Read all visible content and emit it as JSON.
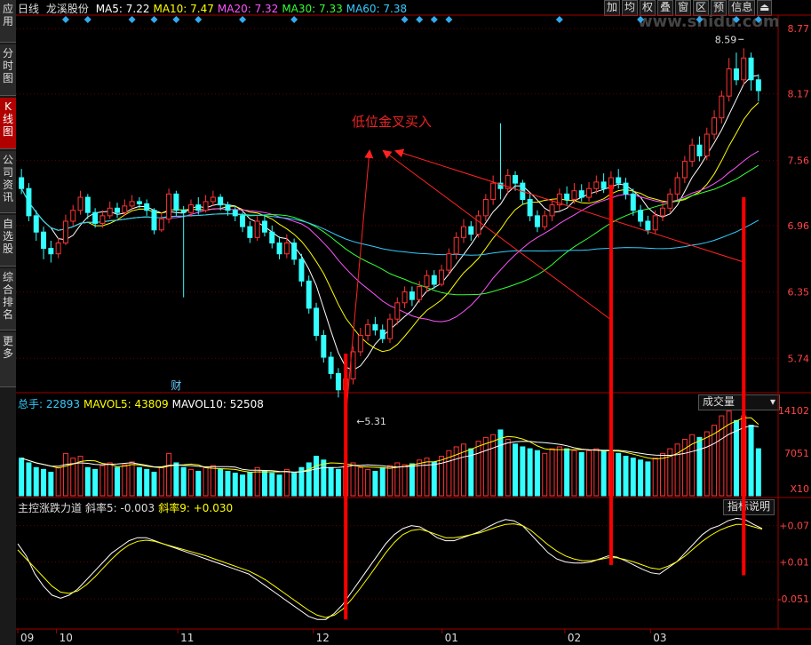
{
  "sidebar": {
    "tabs": [
      {
        "label": "应用",
        "active": false
      },
      {
        "label": "分时图",
        "active": false
      },
      {
        "label": "K线图",
        "active": true
      },
      {
        "label": "公司资讯",
        "active": false
      },
      {
        "label": "自选股",
        "active": false
      },
      {
        "label": "综合排名",
        "active": false
      },
      {
        "label": "更多",
        "active": false
      }
    ]
  },
  "toolbar": {
    "buttons": [
      "加",
      "均",
      "权",
      "叠",
      "窗",
      "区",
      "预",
      "信息"
    ]
  },
  "watermark": "www.shidu.com",
  "header": {
    "period": "日线",
    "name": "龙溪股份",
    "ma": [
      {
        "label": "MA5: 7.22",
        "color": "#ffffff"
      },
      {
        "label": "MA10: 7.47",
        "color": "#ffff00"
      },
      {
        "label": "MA20: 7.32",
        "color": "#ff55ff"
      },
      {
        "label": "MA30: 7.33",
        "color": "#33ff33"
      },
      {
        "label": "MA60: 7.38",
        "color": "#33ccff"
      }
    ]
  },
  "volume_header": {
    "items": [
      {
        "label": "总手: 22893",
        "color": "#33ccff"
      },
      {
        "label": "MAVOL5: 43809",
        "color": "#ffff00"
      },
      {
        "label": "MAVOL10: 52508",
        "color": "#ffffff"
      }
    ],
    "dropdown": "成交量"
  },
  "indicator_header": {
    "items": [
      {
        "label": "主控涨跌力道",
        "color": "#dddddd"
      },
      {
        "label": "斜率5: -0.003",
        "color": "#dddddd"
      },
      {
        "label": "斜率9: +0.030",
        "color": "#ffff00"
      }
    ],
    "button": "指标说明"
  },
  "annotation": "低位金叉买入",
  "price_axis": [
    "8.77",
    "8.17",
    "7.56",
    "6.96",
    "6.35",
    "5.74"
  ],
  "volume_axis": [
    "14102",
    "7051",
    "X10"
  ],
  "indicator_axis": [
    "+0.07",
    "+0.01",
    "-0.051"
  ],
  "x_labels": [
    "09",
    "10",
    "11",
    "12",
    "01",
    "02",
    "03"
  ],
  "finance_marker": "财",
  "colors": {
    "up": "#ff3333",
    "down": "#33ffff",
    "arrow": "#ff2222",
    "ma5": "#ffffff",
    "ma10": "#ffff00",
    "ma20": "#ff55ff",
    "ma30": "#33ff33",
    "ma60": "#33ccff"
  },
  "chart_data": {
    "type": "candlestick",
    "price_range": [
      5.44,
      8.87
    ],
    "high_label": "8.59",
    "low_label": "5.31",
    "diamond_days": [
      6,
      9,
      15,
      18,
      21,
      24,
      30,
      37,
      52,
      54,
      56,
      58,
      73,
      84,
      92,
      97,
      100
    ],
    "candles": [
      [
        7.4,
        7.3,
        7.48,
        7.25
      ],
      [
        7.3,
        7.05,
        7.35,
        7.0
      ],
      [
        7.05,
        6.9,
        7.1,
        6.82
      ],
      [
        6.9,
        6.75,
        6.95,
        6.65
      ],
      [
        6.75,
        6.7,
        6.82,
        6.62
      ],
      [
        6.7,
        6.8,
        6.85,
        6.66
      ],
      [
        6.8,
        7.0,
        7.06,
        6.78
      ],
      [
        7.0,
        7.1,
        7.15,
        6.96
      ],
      [
        7.1,
        7.22,
        7.28,
        7.06
      ],
      [
        7.22,
        7.08,
        7.25,
        7.02
      ],
      [
        7.08,
        6.98,
        7.12,
        6.94
      ],
      [
        6.98,
        7.05,
        7.1,
        6.94
      ],
      [
        7.05,
        7.12,
        7.18,
        7.02
      ],
      [
        7.12,
        7.08,
        7.17,
        7.03
      ],
      [
        7.08,
        7.14,
        7.2,
        7.05
      ],
      [
        7.14,
        7.18,
        7.24,
        7.1
      ],
      [
        7.18,
        7.16,
        7.22,
        7.12
      ],
      [
        7.16,
        7.1,
        7.2,
        7.05
      ],
      [
        7.1,
        6.92,
        7.12,
        6.88
      ],
      [
        6.92,
        7.02,
        7.08,
        6.9
      ],
      [
        7.02,
        7.25,
        7.3,
        6.98
      ],
      [
        7.25,
        7.1,
        7.28,
        7.05
      ],
      [
        7.1,
        7.08,
        7.14,
        6.3
      ],
      [
        7.08,
        7.15,
        7.2,
        7.04
      ],
      [
        7.15,
        7.1,
        7.22,
        7.06
      ],
      [
        7.1,
        7.18,
        7.24,
        7.08
      ],
      [
        7.18,
        7.22,
        7.28,
        7.14
      ],
      [
        7.22,
        7.15,
        7.25,
        7.1
      ],
      [
        7.15,
        7.1,
        7.18,
        7.05
      ],
      [
        7.1,
        7.05,
        7.14,
        7.0
      ],
      [
        7.05,
        6.95,
        7.08,
        6.9
      ],
      [
        6.95,
        6.85,
        7.0,
        6.8
      ],
      [
        6.85,
        7.0,
        7.05,
        6.82
      ],
      [
        7.0,
        6.9,
        7.06,
        6.86
      ],
      [
        6.9,
        6.8,
        6.96,
        6.75
      ],
      [
        6.8,
        6.7,
        6.86,
        6.65
      ],
      [
        6.7,
        6.8,
        6.88,
        6.66
      ],
      [
        6.8,
        6.65,
        6.84,
        6.6
      ],
      [
        6.65,
        6.45,
        6.7,
        6.4
      ],
      [
        6.45,
        6.2,
        6.5,
        6.15
      ],
      [
        6.2,
        5.95,
        6.25,
        5.9
      ],
      [
        5.95,
        5.75,
        6.0,
        5.7
      ],
      [
        5.75,
        5.6,
        5.8,
        5.55
      ],
      [
        5.6,
        5.45,
        5.65,
        5.38
      ],
      [
        5.45,
        5.55,
        5.6,
        5.31
      ],
      [
        5.55,
        5.8,
        5.85,
        5.5
      ],
      [
        5.8,
        5.95,
        6.02,
        5.76
      ],
      [
        5.95,
        6.05,
        6.1,
        5.9
      ],
      [
        6.05,
        6.0,
        6.12,
        5.95
      ],
      [
        6.0,
        5.92,
        6.05,
        5.88
      ],
      [
        5.92,
        6.1,
        6.15,
        5.88
      ],
      [
        6.1,
        6.25,
        6.3,
        6.05
      ],
      [
        6.25,
        6.35,
        6.4,
        6.2
      ],
      [
        6.35,
        6.28,
        6.4,
        6.22
      ],
      [
        6.28,
        6.4,
        6.45,
        6.25
      ],
      [
        6.4,
        6.5,
        6.55,
        6.35
      ],
      [
        6.5,
        6.42,
        6.55,
        6.38
      ],
      [
        6.42,
        6.55,
        6.6,
        6.4
      ],
      [
        6.55,
        6.7,
        6.75,
        6.5
      ],
      [
        6.7,
        6.85,
        6.9,
        6.65
      ],
      [
        6.85,
        6.95,
        7.02,
        6.8
      ],
      [
        6.95,
        6.88,
        7.0,
        6.82
      ],
      [
        6.88,
        7.05,
        7.1,
        6.85
      ],
      [
        7.05,
        7.2,
        7.25,
        7.0
      ],
      [
        7.2,
        7.35,
        7.42,
        7.15
      ],
      [
        7.35,
        7.3,
        7.9,
        7.2
      ],
      [
        7.3,
        7.42,
        7.48,
        7.25
      ],
      [
        7.42,
        7.35,
        7.46,
        7.28
      ],
      [
        7.35,
        7.2,
        7.38,
        7.15
      ],
      [
        7.2,
        7.05,
        7.25,
        7.0
      ],
      [
        7.05,
        6.95,
        7.1,
        6.9
      ],
      [
        6.95,
        7.05,
        7.1,
        6.92
      ],
      [
        7.05,
        7.15,
        7.2,
        7.0
      ],
      [
        7.15,
        7.25,
        7.3,
        7.1
      ],
      [
        7.25,
        7.2,
        7.32,
        7.15
      ],
      [
        7.2,
        7.28,
        7.35,
        7.16
      ],
      [
        7.28,
        7.22,
        7.34,
        7.18
      ],
      [
        7.22,
        7.3,
        7.36,
        7.18
      ],
      [
        7.3,
        7.36,
        7.42,
        7.25
      ],
      [
        7.36,
        7.3,
        7.44,
        7.26
      ],
      [
        7.3,
        7.4,
        7.46,
        7.26
      ],
      [
        7.4,
        7.35,
        7.48,
        7.3
      ],
      [
        7.35,
        7.25,
        7.4,
        7.2
      ],
      [
        7.25,
        7.1,
        7.3,
        7.05
      ],
      [
        7.1,
        7.0,
        7.15,
        6.95
      ],
      [
        7.0,
        6.92,
        7.05,
        6.88
      ],
      [
        6.92,
        7.05,
        7.1,
        6.88
      ],
      [
        7.05,
        7.12,
        7.18,
        7.0
      ],
      [
        7.12,
        7.25,
        7.3,
        7.08
      ],
      [
        7.25,
        7.4,
        7.45,
        7.2
      ],
      [
        7.4,
        7.55,
        7.6,
        7.35
      ],
      [
        7.55,
        7.7,
        7.76,
        7.5
      ],
      [
        7.7,
        7.6,
        7.78,
        7.55
      ],
      [
        7.6,
        7.8,
        7.86,
        7.56
      ],
      [
        7.8,
        7.95,
        8.02,
        7.75
      ],
      [
        7.95,
        8.15,
        8.2,
        7.9
      ],
      [
        8.15,
        8.4,
        8.5,
        8.1
      ],
      [
        8.4,
        8.3,
        8.55,
        8.25
      ],
      [
        8.3,
        8.5,
        8.59,
        8.25
      ],
      [
        8.5,
        8.3,
        8.55,
        8.2
      ],
      [
        8.3,
        8.2,
        8.35,
        8.1
      ]
    ],
    "volumes": [
      40,
      35,
      30,
      28,
      25,
      30,
      45,
      40,
      42,
      30,
      28,
      32,
      35,
      30,
      33,
      36,
      30,
      28,
      25,
      30,
      45,
      35,
      30,
      28,
      26,
      30,
      32,
      28,
      26,
      24,
      22,
      25,
      30,
      26,
      24,
      22,
      28,
      24,
      30,
      35,
      42,
      38,
      30,
      28,
      32,
      35,
      30,
      28,
      26,
      30,
      32,
      35,
      33,
      34,
      38,
      40,
      36,
      42,
      48,
      52,
      55,
      50,
      58,
      62,
      65,
      70,
      60,
      55,
      52,
      50,
      48,
      45,
      50,
      52,
      50,
      48,
      46,
      48,
      50,
      48,
      46,
      45,
      42,
      40,
      38,
      36,
      40,
      45,
      50,
      55,
      60,
      65,
      62,
      68,
      75,
      85,
      90,
      80,
      85,
      75,
      50
    ],
    "indicator": {
      "line5": [
        0.04,
        0.02,
        -0.01,
        -0.03,
        -0.045,
        -0.05,
        -0.045,
        -0.035,
        -0.02,
        -0.005,
        0.01,
        0.025,
        0.035,
        0.045,
        0.05,
        0.05,
        0.045,
        0.04,
        0.035,
        0.03,
        0.025,
        0.02,
        0.015,
        0.01,
        0.005,
        0.0,
        -0.005,
        -0.01,
        -0.02,
        -0.03,
        -0.04,
        -0.05,
        -0.06,
        -0.07,
        -0.08,
        -0.085,
        -0.085,
        -0.075,
        -0.06,
        -0.04,
        -0.02,
        0.0,
        0.02,
        0.04,
        0.055,
        0.065,
        0.07,
        0.068,
        0.06,
        0.05,
        0.045,
        0.045,
        0.05,
        0.055,
        0.06,
        0.068,
        0.075,
        0.08,
        0.078,
        0.07,
        0.055,
        0.04,
        0.025,
        0.015,
        0.01,
        0.008,
        0.008,
        0.01,
        0.015,
        0.02,
        0.018,
        0.012,
        0.005,
        -0.002,
        -0.008,
        -0.01,
        0.0,
        0.01,
        0.025,
        0.04,
        0.055,
        0.065,
        0.07,
        0.078,
        0.082,
        0.08,
        0.072,
        0.065
      ],
      "line9": [
        0.03,
        0.015,
        0.0,
        -0.015,
        -0.03,
        -0.04,
        -0.042,
        -0.038,
        -0.028,
        -0.015,
        0.0,
        0.015,
        0.028,
        0.038,
        0.044,
        0.046,
        0.044,
        0.04,
        0.036,
        0.032,
        0.028,
        0.024,
        0.02,
        0.015,
        0.01,
        0.005,
        0.0,
        -0.005,
        -0.012,
        -0.02,
        -0.03,
        -0.04,
        -0.05,
        -0.06,
        -0.07,
        -0.078,
        -0.082,
        -0.078,
        -0.068,
        -0.052,
        -0.034,
        -0.015,
        0.005,
        0.025,
        0.042,
        0.055,
        0.062,
        0.064,
        0.06,
        0.055,
        0.05,
        0.05,
        0.052,
        0.055,
        0.058,
        0.063,
        0.068,
        0.072,
        0.073,
        0.07,
        0.062,
        0.05,
        0.038,
        0.028,
        0.02,
        0.015,
        0.012,
        0.012,
        0.014,
        0.017,
        0.017,
        0.014,
        0.01,
        0.005,
        0.0,
        -0.002,
        0.003,
        0.01,
        0.02,
        0.032,
        0.044,
        0.054,
        0.062,
        0.068,
        0.072,
        0.072,
        0.068,
        0.064
      ]
    }
  }
}
